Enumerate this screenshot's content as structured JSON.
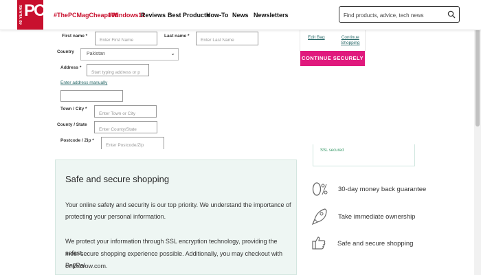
{
  "header": {
    "logo_text": "PC",
    "logo_side_text": "40 YEARS",
    "nav": [
      {
        "label": "#ThePCMagCheap100",
        "red": true
      },
      {
        "label": "#Windows11",
        "red": true
      },
      {
        "label": "Reviews",
        "red": false
      },
      {
        "label": "Best Products",
        "red": false
      },
      {
        "label": "How-To",
        "red": false
      },
      {
        "label": "News",
        "red": false
      },
      {
        "label": "Newsletters",
        "red": false
      }
    ],
    "search_placeholder": "Find products, advice, tech news"
  },
  "form": {
    "first_name_label": "First name *",
    "first_name_placeholder": "Enter First Name",
    "last_name_label": "Last name *",
    "last_name_placeholder": "Enter Last Name",
    "country_label": "Country",
    "country_value": "Pakistan",
    "address_label": "Address *",
    "address_placeholder": "Start typing address or p",
    "enter_manually": "Enter address manually",
    "town_label": "Town / City *",
    "town_placeholder": "Enter Town or City",
    "county_label": "County / State",
    "county_placeholder": "Enter County/State",
    "postcode_label": "Postcode / Zip *",
    "postcode_placeholder": "Enter Postcode/Zip"
  },
  "summary": {
    "edit_bag": "Edit Bag",
    "continue_shopping_1": "Continue",
    "continue_shopping_2": "Shopping",
    "continue_securely": "CONTINUE SECURELY",
    "ssl_text": "SSL secured"
  },
  "safe": {
    "title": "Safe and secure shopping",
    "para1_line1": "Your online safety and security is our top priority. We understand the importance of",
    "para1_line2": "protecting your personal information.",
    "para2_line1": "We protect your information through SSL encryption technology, providing the safest,",
    "para2_line2": "most secure shopping experience possible. Additionally, you may checkout with PayPal",
    "para2_line3": "or Escrow.com."
  },
  "guarantees": [
    {
      "icon": "zero-percent-icon",
      "text": "30-day money back guarantee"
    },
    {
      "icon": "rocket-icon",
      "text": "Take immediate ownership"
    },
    {
      "icon": "thumbs-up-icon",
      "text": "Safe and secure shopping"
    }
  ],
  "colors": {
    "brand_red": "#c8102e",
    "button_pink": "#e0197d",
    "safe_bg": "#eef6f3"
  }
}
